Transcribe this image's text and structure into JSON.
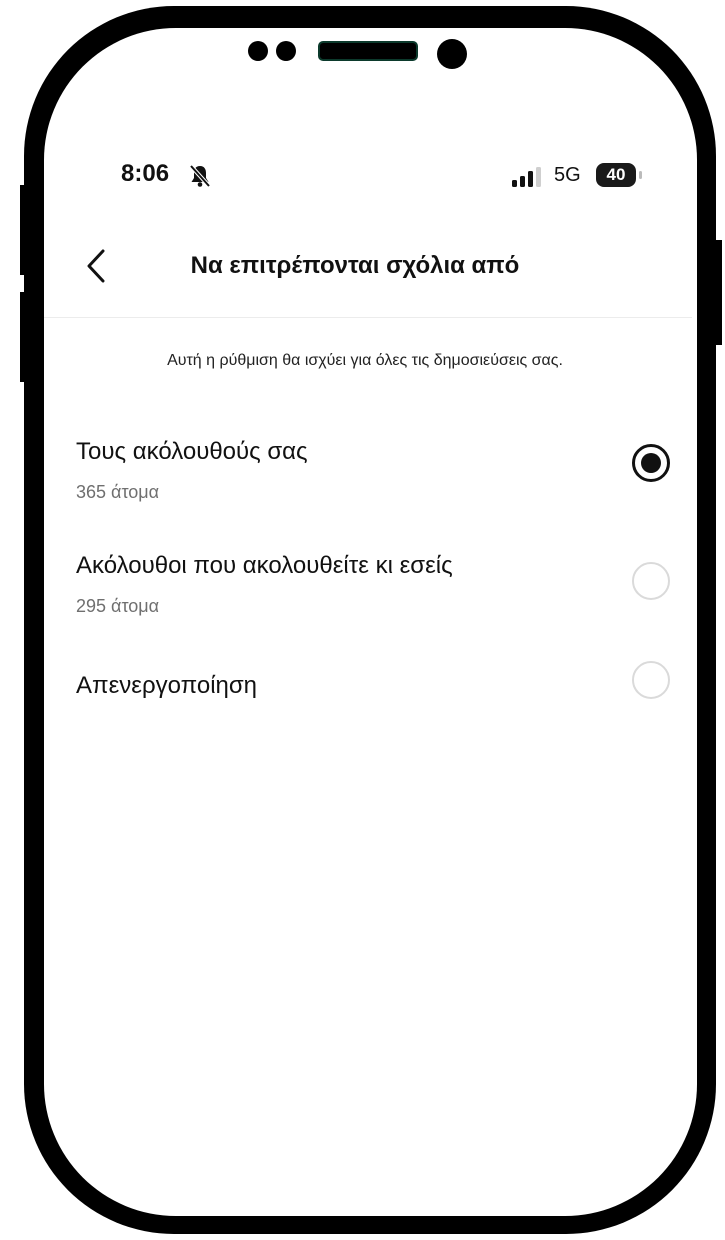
{
  "status_bar": {
    "time": "8:06",
    "network": "5G",
    "battery": "40",
    "icons": [
      "bell-muted-icon",
      "signal-icon"
    ]
  },
  "header": {
    "title": "Να επιτρέπονται σχόλια από",
    "back_icon": "chevron-left-icon"
  },
  "description": "Αυτή η ρύθμιση θα ισχύει για όλες τις δημοσιεύσεις σας.",
  "options": [
    {
      "label": "Τους ακόλουθούς σας",
      "sublabel": "365 άτομα",
      "selected": true
    },
    {
      "label": "Ακόλουθοι που ακολουθείτε κι εσείς",
      "sublabel": "295 άτομα",
      "selected": false
    },
    {
      "label": "Απενεργοποίηση",
      "sublabel": "",
      "selected": false
    }
  ],
  "colors": {
    "selected_radio": "#111111",
    "unselected_radio": "#dadada",
    "subtext": "#6f6f6f"
  }
}
